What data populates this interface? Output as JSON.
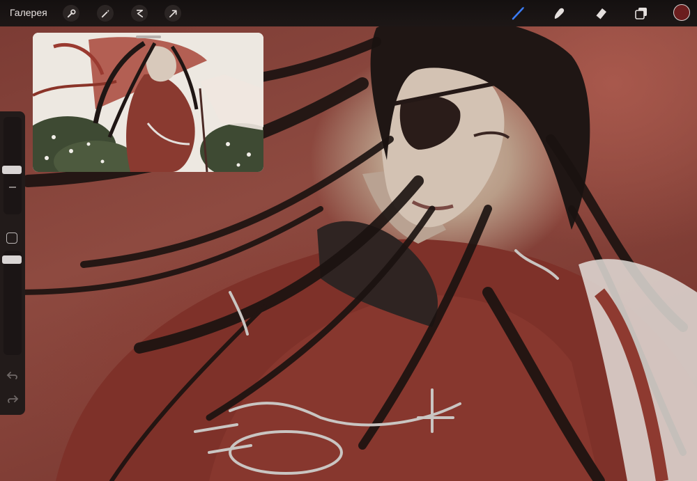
{
  "toolbar": {
    "gallery_label": "Галерея",
    "left_tools": [
      "wrench-icon",
      "magic-wand-icon",
      "selection-icon",
      "transform-arrow-icon"
    ],
    "right_tools": [
      "brush-icon",
      "smudge-icon",
      "eraser-icon",
      "layers-icon"
    ],
    "active_tool": "brush-icon",
    "current_color": "#6b1e1e",
    "accent_color": "#3b7cf5"
  },
  "sidebar": {
    "brush_size_level": 0.45,
    "opacity_level": 0.95,
    "icons": [
      "modify-button-icon",
      "undo-icon",
      "redo-icon"
    ]
  },
  "reference_window": {
    "visible": true
  }
}
